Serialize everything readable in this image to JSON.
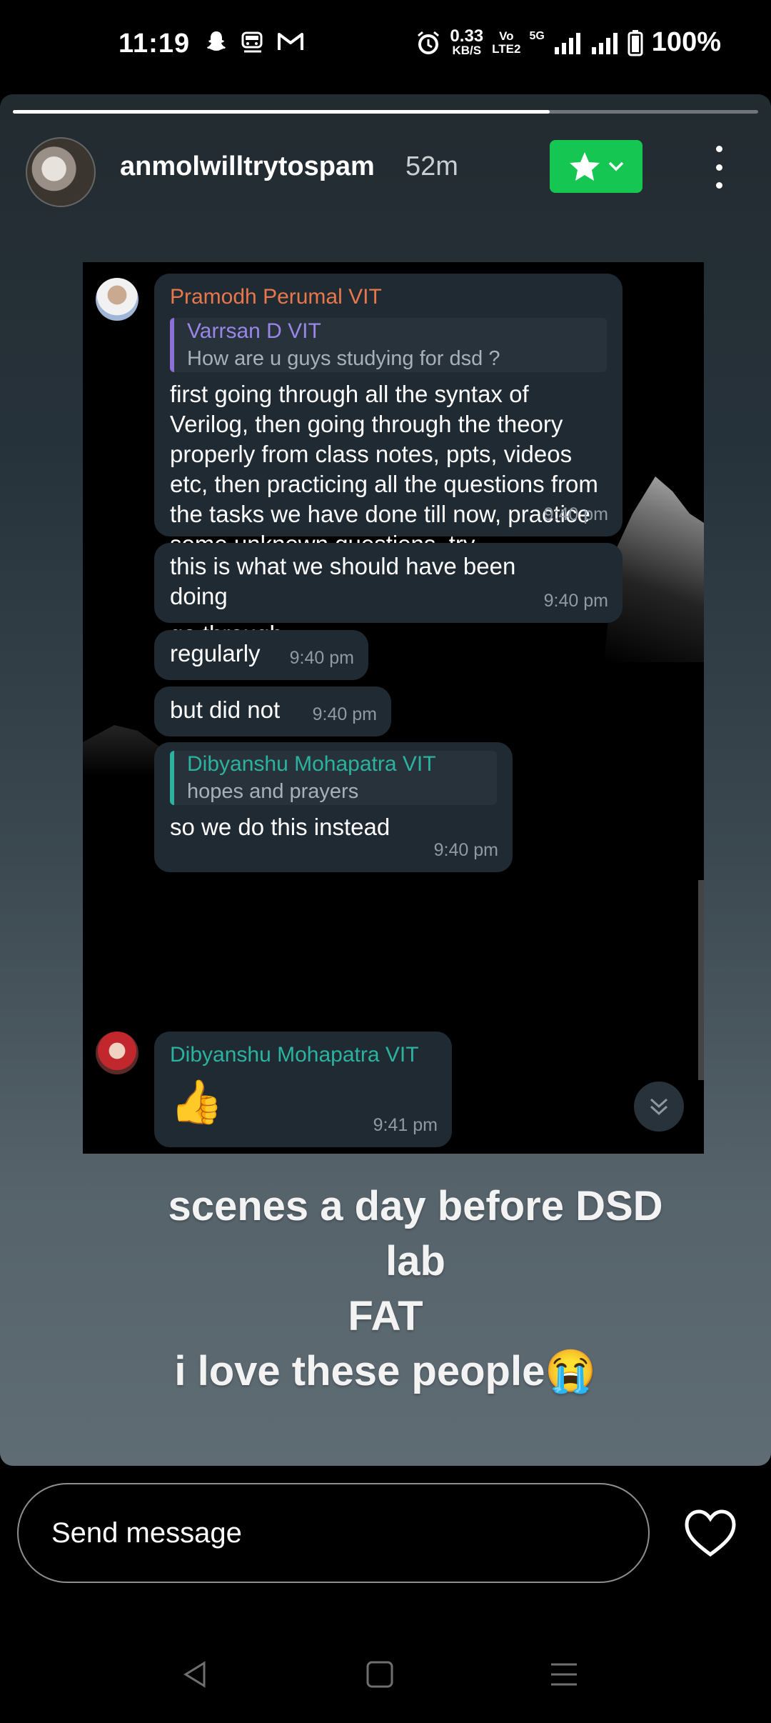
{
  "status_bar": {
    "time": "11:19",
    "net_speed_value": "0.33",
    "net_speed_unit": "KB/S",
    "volte_top": "Vo",
    "volte_bottom": "LTE2",
    "network": "5G",
    "battery": "100%"
  },
  "story": {
    "progress_fraction": 0.72,
    "username": "anmolwilltrytospam",
    "time_ago": "52m",
    "caption_lines": [
      "scenes a day before DSD lab",
      "FAT",
      "i love these people😭"
    ]
  },
  "chat": {
    "messages": [
      {
        "sender": "Pramodh Perumal VIT",
        "reply_name": "Varrsan D VIT",
        "reply_text": "How are u guys studying for dsd ?",
        "text": "first going through all the syntax of Verilog, then going through the theory properly from class notes, ppts, videos etc, then practicing all the questions from the tasks we have done till now, practice some unknown questions, try challenging questions which have not been done in class till now and do a final go through",
        "time": "9:40 pm"
      },
      {
        "text": "this is what we should have been doing",
        "time": "9:40 pm"
      },
      {
        "text": "regularly",
        "time": "9:40 pm"
      },
      {
        "text": "but did not",
        "time": "9:40 pm"
      },
      {
        "reply_name": "Dibyanshu Mohapatra VIT",
        "reply_text": "hopes and prayers",
        "text": "so we do this instead",
        "time": "9:40 pm"
      },
      {
        "sender": "Dibyanshu Mohapatra VIT",
        "text": "👍",
        "time": "9:41 pm"
      }
    ]
  },
  "bottom": {
    "send_placeholder": "Send message"
  },
  "colors": {
    "favorite_green": "#16c653",
    "sender_orange": "#e8774b",
    "reply_purple": "#9a86e8",
    "sender_teal": "#2bb3a0"
  }
}
